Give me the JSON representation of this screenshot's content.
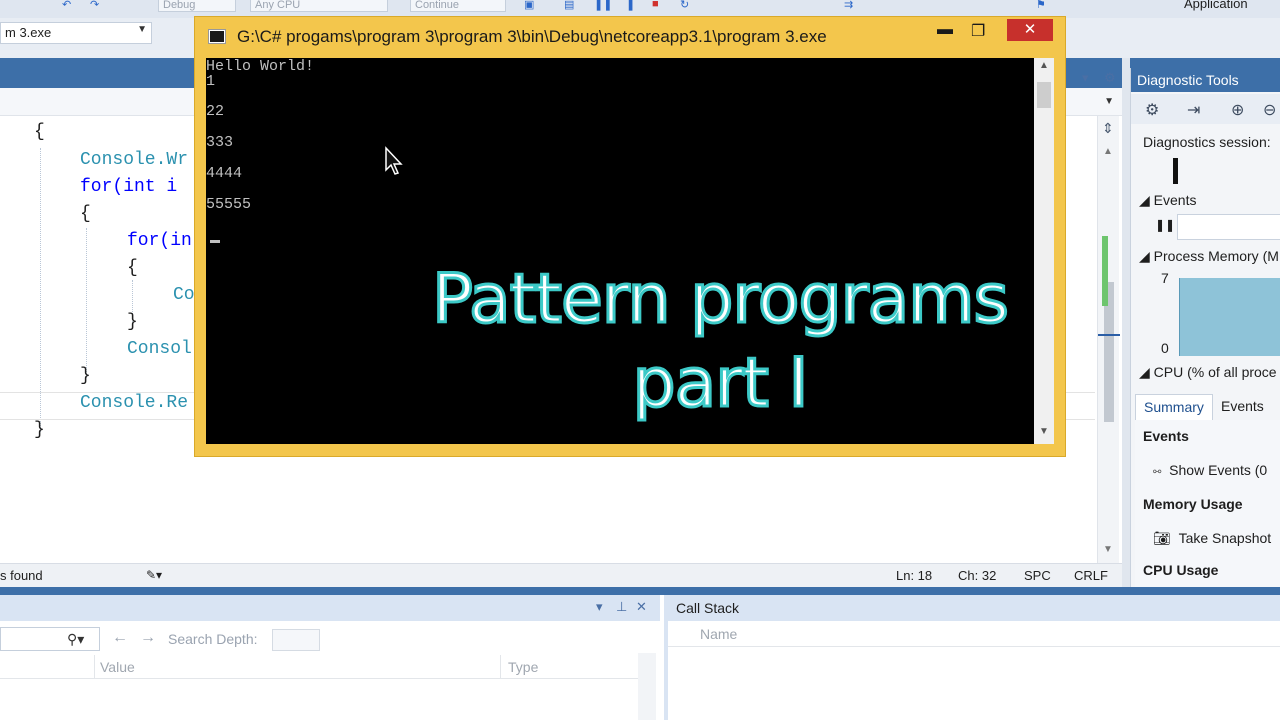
{
  "toolbar": {
    "config_dropdown": "Debug",
    "platform_dropdown": "Any CPU",
    "continue_label": "Continue",
    "app_insights_label": "Application",
    "process_dropdown": "m 3.exe"
  },
  "editor": {
    "code_lines": [
      "{",
      "Console.Wr",
      "for(int i",
      "{",
      "for(in",
      "{",
      "Co",
      "}",
      "Consol",
      "}",
      "Console.Re",
      "}"
    ],
    "status": {
      "issues": "s found",
      "line": "Ln: 18",
      "col": "Ch: 32",
      "mode": "SPC",
      "line_ending": "CRLF"
    }
  },
  "console": {
    "title": "G:\\C# progams\\program 3\\program 3\\bin\\Debug\\netcoreapp3.1\\program 3.exe",
    "output": [
      "Hello World!",
      "1",
      "",
      "22",
      "",
      "333",
      "",
      "4444",
      "",
      "55555"
    ]
  },
  "overlay": {
    "line1": "Pattern programs",
    "line2": "part I"
  },
  "diagnostic_tools": {
    "title": "Diagnostic Tools",
    "session_label": "Diagnostics session:",
    "events_header": "Events",
    "process_memory_header": "Process Memory (M",
    "memory_max": "7",
    "memory_min": "0",
    "cpu_header": "CPU (% of all proce",
    "tabs": [
      "Summary",
      "Events"
    ],
    "summary": {
      "events_heading": "Events",
      "show_events": "Show Events (0",
      "memory_heading": "Memory Usage",
      "take_snapshot": "Take Snapshot",
      "cpu_heading": "CPU Usage"
    }
  },
  "locals": {
    "search_depth_label": "Search Depth:",
    "columns": [
      "Value",
      "Type"
    ]
  },
  "call_stack": {
    "title": "Call Stack",
    "columns": [
      "Name"
    ]
  },
  "colors": {
    "console_frame": "#f3c64c",
    "close_button": "#c7302c",
    "overlay_stroke": "#3cc9c7",
    "vs_blue": "#3d6fa8"
  }
}
